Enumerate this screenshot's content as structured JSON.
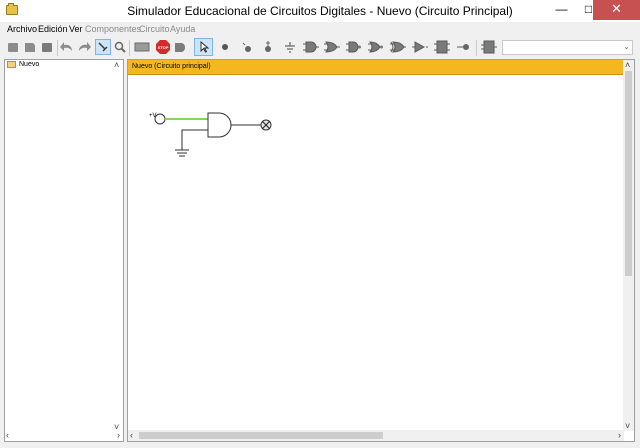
{
  "window": {
    "title": "Simulador Educacional de Circuitos Digitales - Nuevo (Circuito Principal)",
    "minimize_glyph": "—",
    "maximize_glyph": "□",
    "close_glyph": "✕"
  },
  "menu": {
    "items": [
      {
        "label": "Archivo",
        "enabled": true
      },
      {
        "label": "Edición",
        "enabled": true
      },
      {
        "label": "Ver",
        "enabled": true
      },
      {
        "label": "Componentes",
        "enabled": false
      },
      {
        "label": "Circuito",
        "enabled": false
      },
      {
        "label": "Ayuda",
        "enabled": false
      }
    ]
  },
  "toolbar": {
    "stop_label": "STOP",
    "zoom_value": ""
  },
  "tree": {
    "root_label": "Nuevo"
  },
  "editor": {
    "tab_title": "Nuevo (Circuito principal)",
    "vcc_label": "+V",
    "wire_active_color": "#7ed957"
  }
}
